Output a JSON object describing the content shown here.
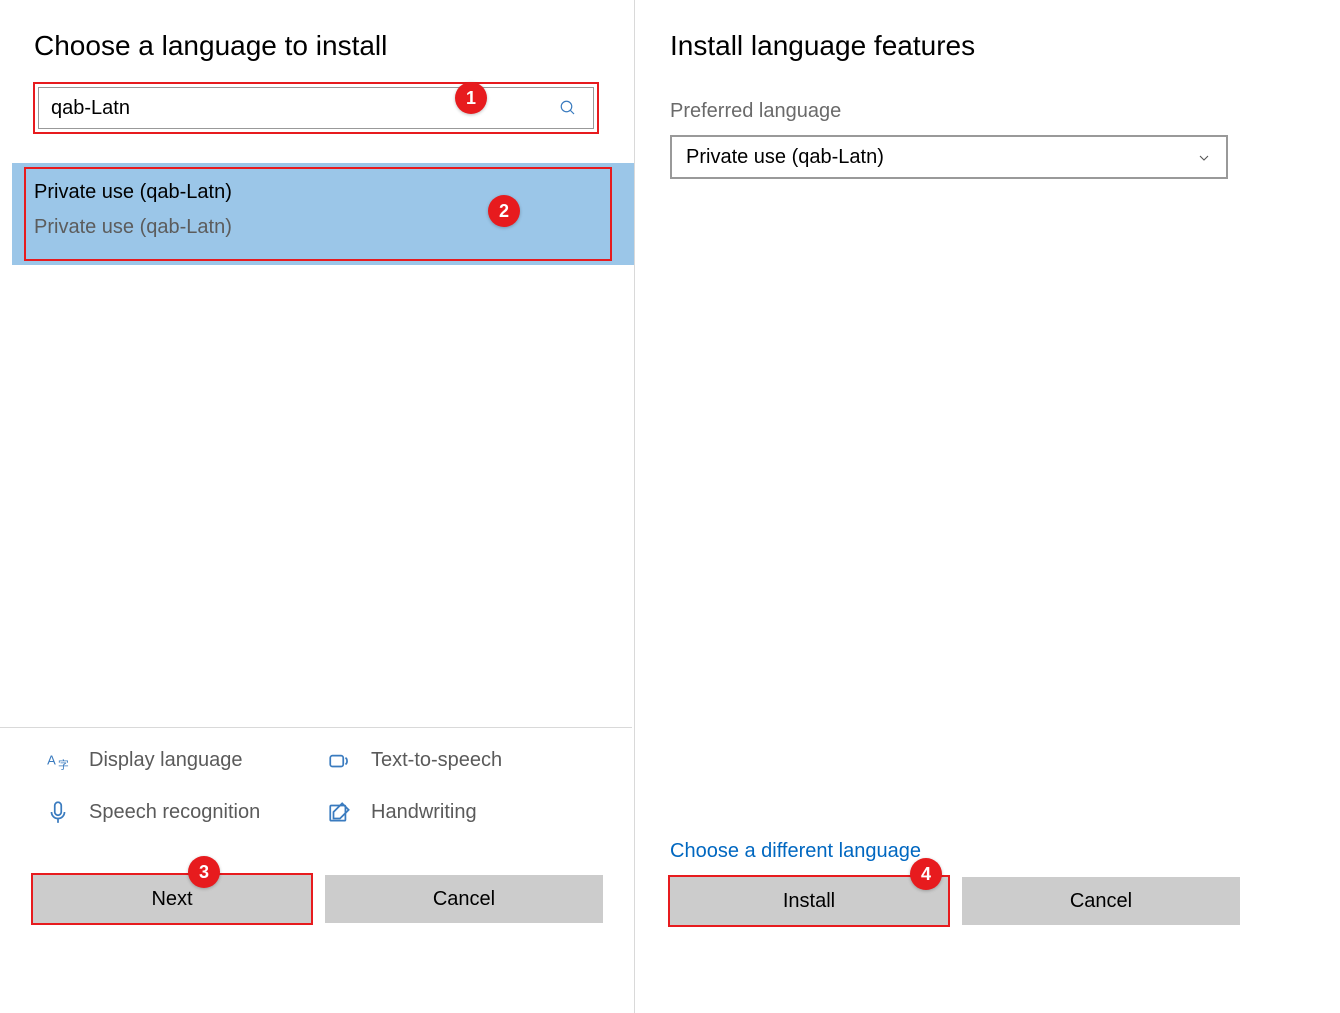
{
  "left": {
    "title": "Choose a language to install",
    "search_value": "qab-Latn",
    "result": {
      "line1": "Private use (qab-Latn)",
      "line2": "Private use (qab-Latn)"
    },
    "features": {
      "display_language": "Display language",
      "text_to_speech": "Text-to-speech",
      "speech_recognition": "Speech recognition",
      "handwriting": "Handwriting"
    },
    "next_label": "Next",
    "cancel_label": "Cancel"
  },
  "right": {
    "title": "Install language features",
    "preferred_language_label": "Preferred language",
    "dropdown_value": "Private use (qab-Latn)",
    "choose_different": "Choose a different language",
    "install_label": "Install",
    "cancel_label": "Cancel"
  },
  "annotations": {
    "a1": "1",
    "a2": "2",
    "a3": "3",
    "a4": "4"
  }
}
